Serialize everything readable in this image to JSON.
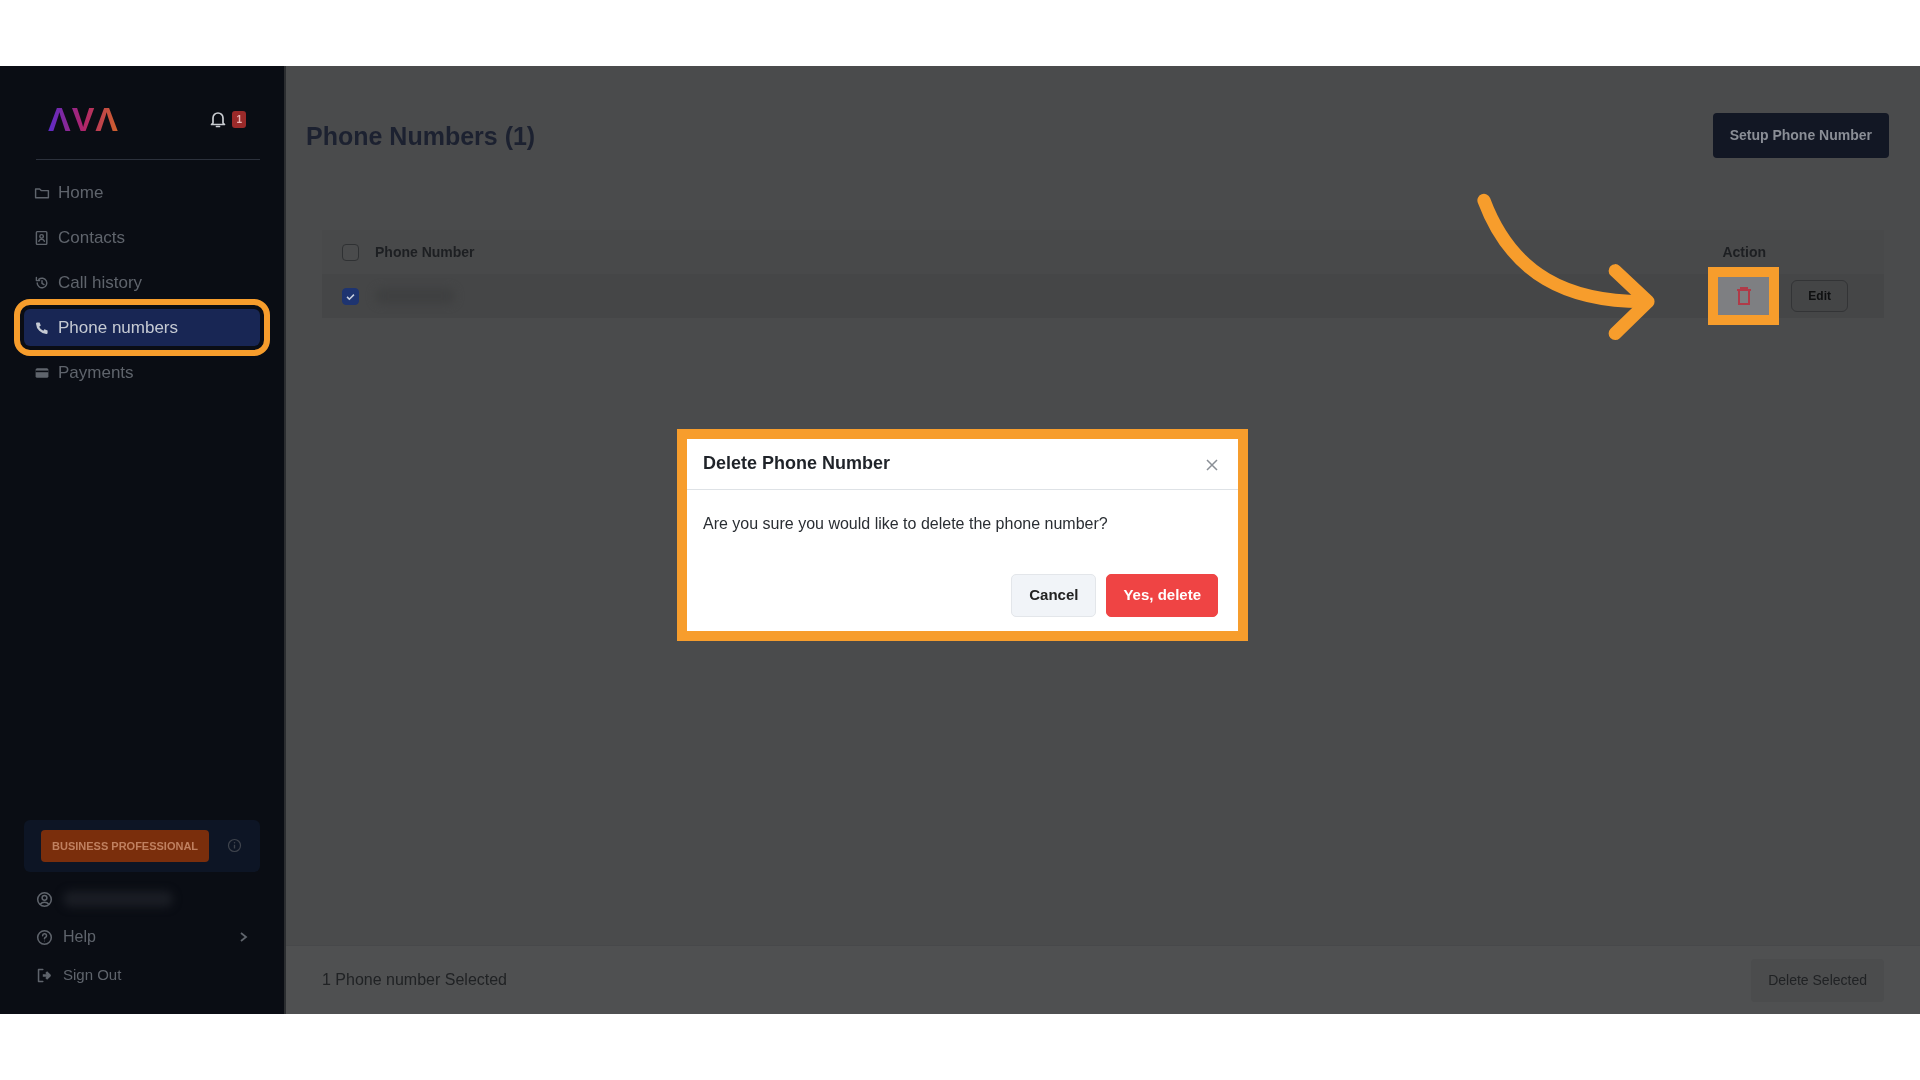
{
  "sidebar": {
    "logo": "ΛVΛ",
    "notification_count": "1",
    "nav": [
      {
        "label": "Home",
        "kind": "folder",
        "selected": false,
        "highlighted": false
      },
      {
        "label": "Contacts",
        "kind": "contacts",
        "selected": false,
        "highlighted": false
      },
      {
        "label": "Call history",
        "kind": "history",
        "selected": false,
        "highlighted": false
      },
      {
        "label": "Phone numbers",
        "kind": "phone",
        "selected": true,
        "highlighted": true
      },
      {
        "label": "Payments",
        "kind": "card",
        "selected": false,
        "highlighted": false
      }
    ],
    "plan": "BUSINESS PROFESSIONAL",
    "account": [
      {
        "kind": "user"
      },
      {
        "kind": "help",
        "label": "Help"
      },
      {
        "kind": "signout",
        "label": "Sign Out"
      }
    ]
  },
  "page": {
    "title": "Phone Numbers (1)",
    "setup_button": "Setup Phone Number"
  },
  "table": {
    "columns": [
      "Phone Number",
      "Action"
    ],
    "header_checked": false,
    "rows": [
      {
        "checked": true,
        "delete_highlighted": true,
        "edit": "Edit"
      }
    ]
  },
  "footer": {
    "status": "1 Phone number Selected",
    "button": "Delete Selected"
  },
  "modal": {
    "title": "Delete Phone Number",
    "message": "Are you sure you would like to delete the phone number?",
    "highlighted": true,
    "buttons": [
      {
        "label": "Cancel",
        "kind": "secondary"
      },
      {
        "label": "Yes, delete",
        "kind": "danger"
      }
    ]
  }
}
